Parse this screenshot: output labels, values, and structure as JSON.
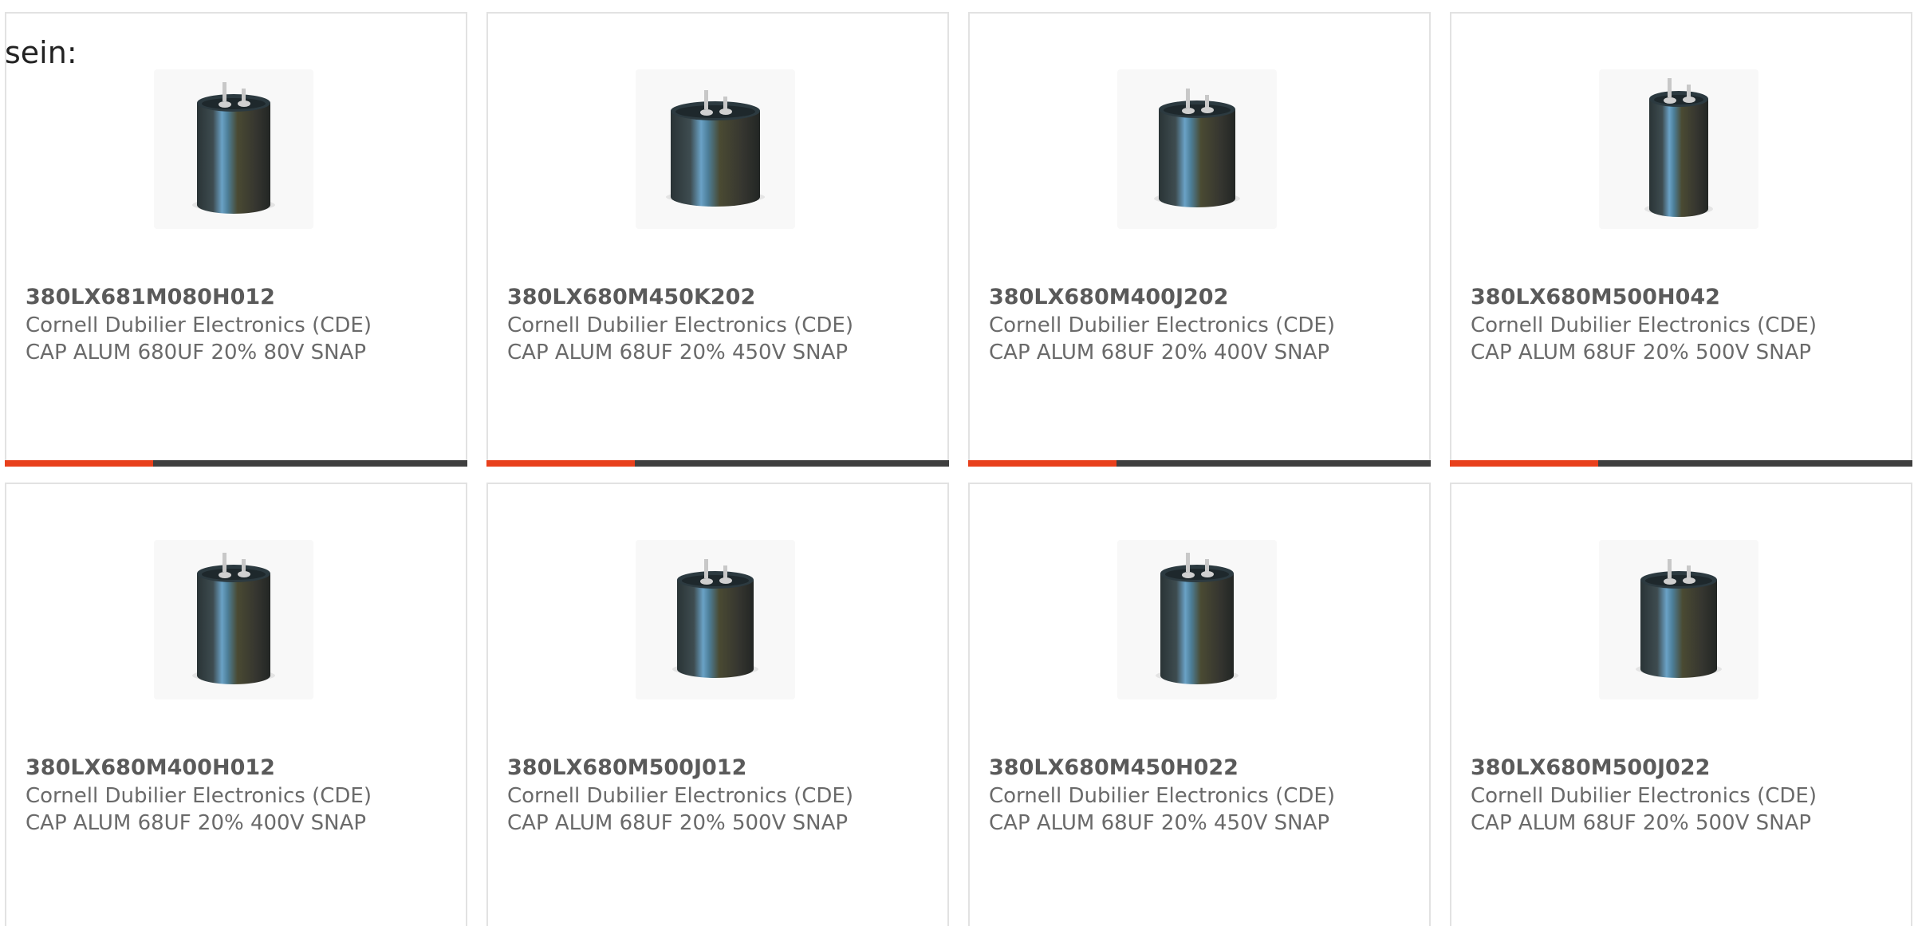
{
  "intro_text": "sein:",
  "products": [
    {
      "part_number": "380LX681M080H012",
      "manufacturer": "Cornell Dubilier Electronics (CDE)",
      "description": "CAP ALUM 680UF 20% 80V SNAP",
      "image_icon": "capacitor-icon",
      "progress": 0.32,
      "shape": "tall"
    },
    {
      "part_number": "380LX680M450K202",
      "manufacturer": "Cornell Dubilier Electronics (CDE)",
      "description": "CAP ALUM 68UF 20% 450V SNAP",
      "image_icon": "capacitor-icon",
      "progress": 0.32,
      "shape": "wide"
    },
    {
      "part_number": "380LX680M400J202",
      "manufacturer": "Cornell Dubilier Electronics (CDE)",
      "description": "CAP ALUM 68UF 20% 400V SNAP",
      "image_icon": "capacitor-icon",
      "progress": 0.32,
      "shape": "medium"
    },
    {
      "part_number": "380LX680M500H042",
      "manufacturer": "Cornell Dubilier Electronics (CDE)",
      "description": "CAP ALUM 68UF 20% 500V SNAP",
      "image_icon": "capacitor-icon",
      "progress": 0.32,
      "shape": "slim"
    },
    {
      "part_number": "380LX680M400H012",
      "manufacturer": "Cornell Dubilier Electronics (CDE)",
      "description": "CAP ALUM 68UF 20% 400V SNAP",
      "image_icon": "capacitor-icon",
      "progress": null,
      "shape": "tall"
    },
    {
      "part_number": "380LX680M500J012",
      "manufacturer": "Cornell Dubilier Electronics (CDE)",
      "description": "CAP ALUM 68UF 20% 500V SNAP",
      "image_icon": "capacitor-icon",
      "progress": null,
      "shape": "medium"
    },
    {
      "part_number": "380LX680M450H022",
      "manufacturer": "Cornell Dubilier Electronics (CDE)",
      "description": "CAP ALUM 68UF 20% 450V SNAP",
      "image_icon": "capacitor-icon",
      "progress": null,
      "shape": "tall"
    },
    {
      "part_number": "380LX680M500J022",
      "manufacturer": "Cornell Dubilier Electronics (CDE)",
      "description": "CAP ALUM 68UF 20% 500V SNAP",
      "image_icon": "capacitor-icon",
      "progress": null,
      "shape": "medium"
    }
  ],
  "colors": {
    "progress_fill": "#e8401c",
    "progress_track": "#3f3f3f",
    "card_border": "#e2e2e2",
    "part_number_text": "#5a5a5a",
    "body_text": "#6a6a6a"
  }
}
